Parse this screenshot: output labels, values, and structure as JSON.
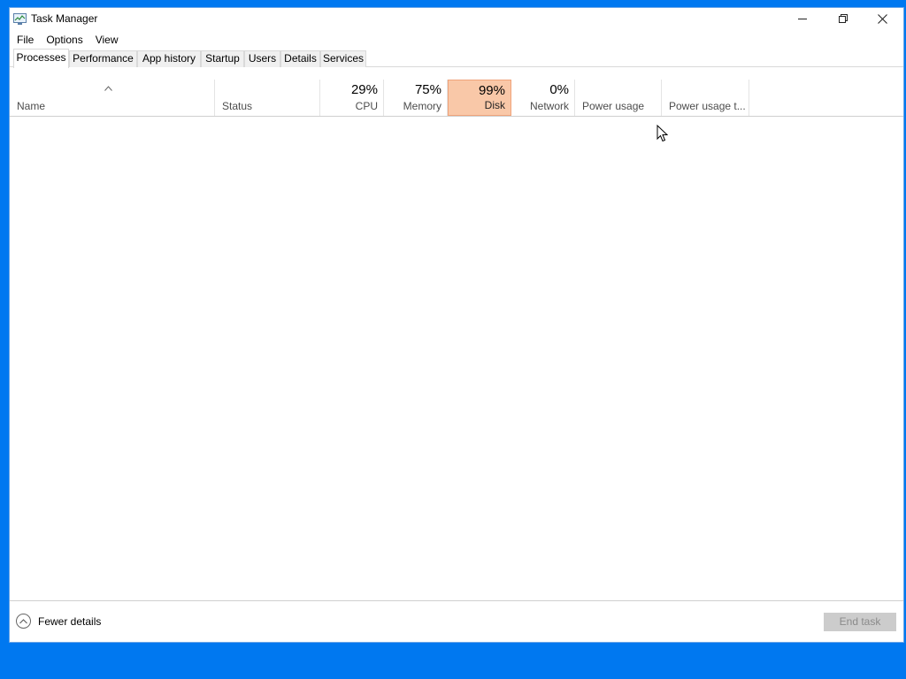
{
  "window": {
    "title": "Task Manager",
    "icon": "task-manager-icon",
    "controls": {
      "minimize": "minimize-icon",
      "restore": "restore-icon",
      "close": "close-icon"
    }
  },
  "menu": {
    "file": "File",
    "options": "Options",
    "view": "View"
  },
  "tabs": [
    {
      "label": "Processes",
      "active": true
    },
    {
      "label": "Performance"
    },
    {
      "label": "App history"
    },
    {
      "label": "Startup"
    },
    {
      "label": "Users"
    },
    {
      "label": "Details"
    },
    {
      "label": "Services"
    }
  ],
  "columns": {
    "name": {
      "label": "Name"
    },
    "status": {
      "label": "Status"
    },
    "cpu": {
      "pct": "29%",
      "label": "CPU"
    },
    "memory": {
      "pct": "75%",
      "label": "Memory"
    },
    "disk": {
      "pct": "99%",
      "label": "Disk",
      "highlight": "#f9c8a8"
    },
    "network": {
      "pct": "0%",
      "label": "Network"
    },
    "power": {
      "label": "Power usage"
    },
    "power_trend": {
      "label": "Power usage t..."
    }
  },
  "footer": {
    "fewer_details": "Fewer details",
    "end_task": "End task"
  },
  "colors": {
    "desktop": "#0078f0",
    "disk_highlight": "#f9c8a8"
  }
}
